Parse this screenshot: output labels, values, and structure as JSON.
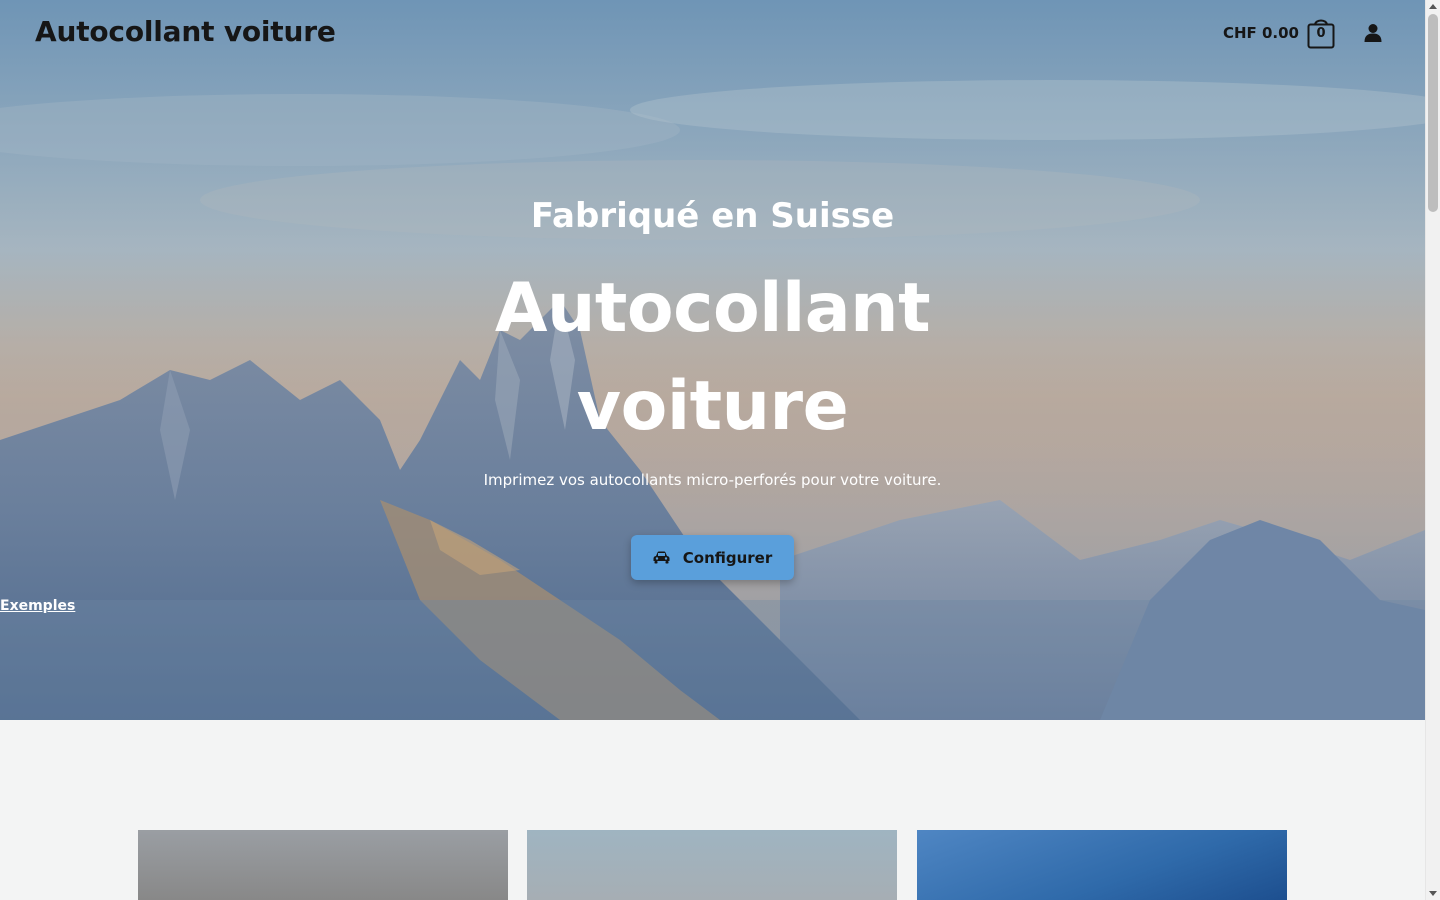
{
  "header": {
    "site_title": "Autocollant voiture",
    "cart_total": "CHF 0.00",
    "cart_count": "0",
    "cart_icon": "shopping-bag-icon",
    "account_icon": "user-icon"
  },
  "hero": {
    "kicker": "Fabriqué en Suisse",
    "headline_line1": "Autocollant",
    "headline_line2": "voiture",
    "subtitle": "Imprimez vos autocollants micro-perforés pour votre voiture.",
    "cta_label": "Configurer",
    "cta_icon": "car-icon",
    "secondary_link": "Exemples",
    "background_image": "mountain-landscape"
  },
  "colors": {
    "accent": "#5a9fdb",
    "text_dark": "#161616",
    "page_bg": "#f3f4f4"
  }
}
